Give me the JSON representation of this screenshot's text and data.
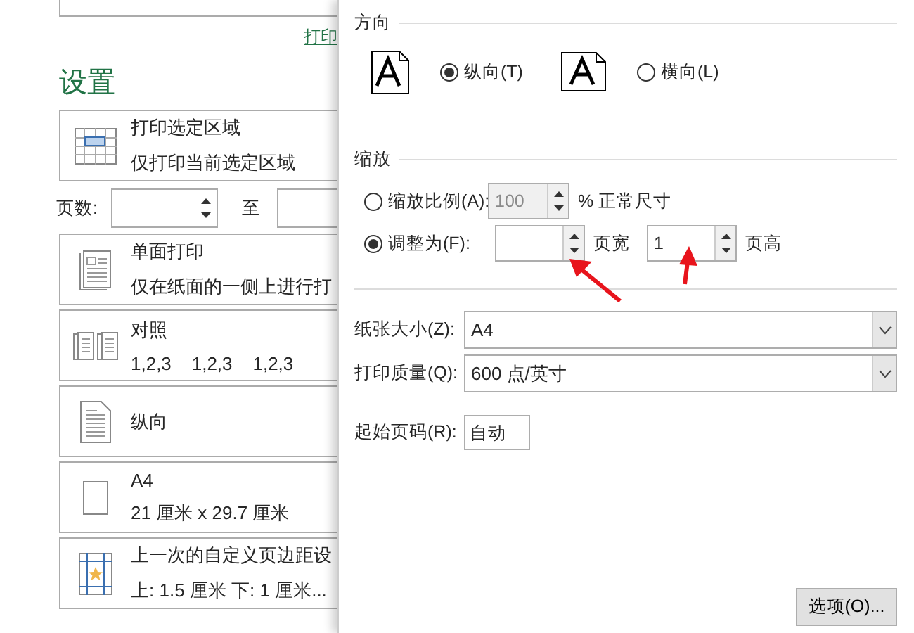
{
  "backstage": {
    "printer_link": "打印",
    "heading": "设置",
    "print_what": {
      "title": "打印选定区域",
      "subtitle": "仅打印当前选定区域"
    },
    "pages": {
      "label": "页数:",
      "to_label": "至"
    },
    "options": [
      {
        "kind": "sides",
        "title": "单面打印",
        "subtitle": "仅在纸面的一侧上进行打"
      },
      {
        "kind": "collate",
        "title": "对照",
        "subtitle": "1,2,3    1,2,3    1,2,3"
      },
      {
        "kind": "orientation",
        "title": "纵向"
      },
      {
        "kind": "paper",
        "title": "A4",
        "subtitle": "21 厘米 x 29.7 厘米"
      },
      {
        "kind": "margins",
        "title": "上一次的自定义页边距设",
        "subtitle": "上: 1.5 厘米 下: 1 厘米..."
      }
    ]
  },
  "dialog": {
    "orientation": {
      "title": "方向",
      "options": [
        {
          "kind": "portrait",
          "label": "纵向(T)",
          "selected": true
        },
        {
          "kind": "landscape",
          "label": "横向(L)",
          "selected": false
        }
      ]
    },
    "scaling": {
      "title": "缩放",
      "adjust": {
        "label": "缩放比例(A):",
        "selected": false,
        "disabled": true,
        "value": "100",
        "suffix": "% 正常尺寸"
      },
      "fit": {
        "label": "调整为(F):",
        "selected": true,
        "wide_suffix": "页宽",
        "tall_value": "1",
        "tall_suffix": "页高"
      }
    },
    "paper_size": {
      "label": "纸张大小(Z):",
      "value": "A4"
    },
    "print_quality": {
      "label": "打印质量(Q):",
      "value": "600 点/英寸"
    },
    "first_page": {
      "label": "起始页码(R):",
      "value": "自动"
    },
    "options_button": "选项(O)..."
  }
}
